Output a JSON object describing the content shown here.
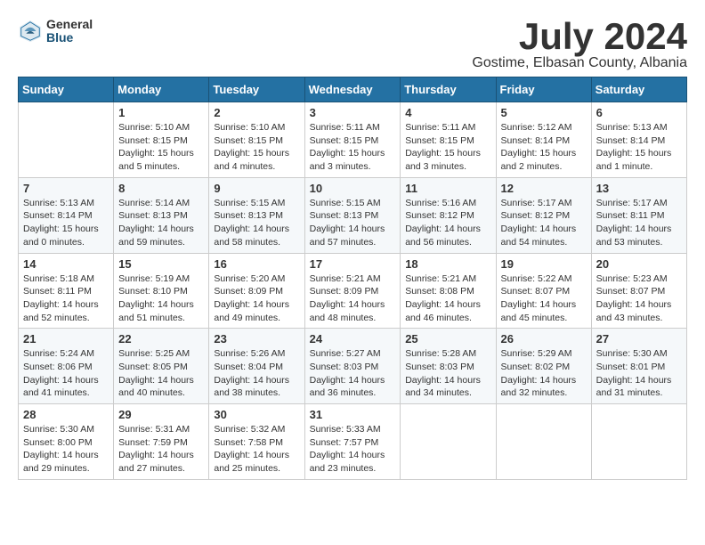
{
  "logo": {
    "general": "General",
    "blue": "Blue"
  },
  "title": "July 2024",
  "subtitle": "Gostime, Elbasan County, Albania",
  "days_of_week": [
    "Sunday",
    "Monday",
    "Tuesday",
    "Wednesday",
    "Thursday",
    "Friday",
    "Saturday"
  ],
  "weeks": [
    [
      {
        "day": "",
        "sunrise": "",
        "sunset": "",
        "daylight": ""
      },
      {
        "day": "1",
        "sunrise": "Sunrise: 5:10 AM",
        "sunset": "Sunset: 8:15 PM",
        "daylight": "Daylight: 15 hours and 5 minutes."
      },
      {
        "day": "2",
        "sunrise": "Sunrise: 5:10 AM",
        "sunset": "Sunset: 8:15 PM",
        "daylight": "Daylight: 15 hours and 4 minutes."
      },
      {
        "day": "3",
        "sunrise": "Sunrise: 5:11 AM",
        "sunset": "Sunset: 8:15 PM",
        "daylight": "Daylight: 15 hours and 3 minutes."
      },
      {
        "day": "4",
        "sunrise": "Sunrise: 5:11 AM",
        "sunset": "Sunset: 8:15 PM",
        "daylight": "Daylight: 15 hours and 3 minutes."
      },
      {
        "day": "5",
        "sunrise": "Sunrise: 5:12 AM",
        "sunset": "Sunset: 8:14 PM",
        "daylight": "Daylight: 15 hours and 2 minutes."
      },
      {
        "day": "6",
        "sunrise": "Sunrise: 5:13 AM",
        "sunset": "Sunset: 8:14 PM",
        "daylight": "Daylight: 15 hours and 1 minute."
      }
    ],
    [
      {
        "day": "7",
        "sunrise": "Sunrise: 5:13 AM",
        "sunset": "Sunset: 8:14 PM",
        "daylight": "Daylight: 15 hours and 0 minutes."
      },
      {
        "day": "8",
        "sunrise": "Sunrise: 5:14 AM",
        "sunset": "Sunset: 8:13 PM",
        "daylight": "Daylight: 14 hours and 59 minutes."
      },
      {
        "day": "9",
        "sunrise": "Sunrise: 5:15 AM",
        "sunset": "Sunset: 8:13 PM",
        "daylight": "Daylight: 14 hours and 58 minutes."
      },
      {
        "day": "10",
        "sunrise": "Sunrise: 5:15 AM",
        "sunset": "Sunset: 8:13 PM",
        "daylight": "Daylight: 14 hours and 57 minutes."
      },
      {
        "day": "11",
        "sunrise": "Sunrise: 5:16 AM",
        "sunset": "Sunset: 8:12 PM",
        "daylight": "Daylight: 14 hours and 56 minutes."
      },
      {
        "day": "12",
        "sunrise": "Sunrise: 5:17 AM",
        "sunset": "Sunset: 8:12 PM",
        "daylight": "Daylight: 14 hours and 54 minutes."
      },
      {
        "day": "13",
        "sunrise": "Sunrise: 5:17 AM",
        "sunset": "Sunset: 8:11 PM",
        "daylight": "Daylight: 14 hours and 53 minutes."
      }
    ],
    [
      {
        "day": "14",
        "sunrise": "Sunrise: 5:18 AM",
        "sunset": "Sunset: 8:11 PM",
        "daylight": "Daylight: 14 hours and 52 minutes."
      },
      {
        "day": "15",
        "sunrise": "Sunrise: 5:19 AM",
        "sunset": "Sunset: 8:10 PM",
        "daylight": "Daylight: 14 hours and 51 minutes."
      },
      {
        "day": "16",
        "sunrise": "Sunrise: 5:20 AM",
        "sunset": "Sunset: 8:09 PM",
        "daylight": "Daylight: 14 hours and 49 minutes."
      },
      {
        "day": "17",
        "sunrise": "Sunrise: 5:21 AM",
        "sunset": "Sunset: 8:09 PM",
        "daylight": "Daylight: 14 hours and 48 minutes."
      },
      {
        "day": "18",
        "sunrise": "Sunrise: 5:21 AM",
        "sunset": "Sunset: 8:08 PM",
        "daylight": "Daylight: 14 hours and 46 minutes."
      },
      {
        "day": "19",
        "sunrise": "Sunrise: 5:22 AM",
        "sunset": "Sunset: 8:07 PM",
        "daylight": "Daylight: 14 hours and 45 minutes."
      },
      {
        "day": "20",
        "sunrise": "Sunrise: 5:23 AM",
        "sunset": "Sunset: 8:07 PM",
        "daylight": "Daylight: 14 hours and 43 minutes."
      }
    ],
    [
      {
        "day": "21",
        "sunrise": "Sunrise: 5:24 AM",
        "sunset": "Sunset: 8:06 PM",
        "daylight": "Daylight: 14 hours and 41 minutes."
      },
      {
        "day": "22",
        "sunrise": "Sunrise: 5:25 AM",
        "sunset": "Sunset: 8:05 PM",
        "daylight": "Daylight: 14 hours and 40 minutes."
      },
      {
        "day": "23",
        "sunrise": "Sunrise: 5:26 AM",
        "sunset": "Sunset: 8:04 PM",
        "daylight": "Daylight: 14 hours and 38 minutes."
      },
      {
        "day": "24",
        "sunrise": "Sunrise: 5:27 AM",
        "sunset": "Sunset: 8:03 PM",
        "daylight": "Daylight: 14 hours and 36 minutes."
      },
      {
        "day": "25",
        "sunrise": "Sunrise: 5:28 AM",
        "sunset": "Sunset: 8:03 PM",
        "daylight": "Daylight: 14 hours and 34 minutes."
      },
      {
        "day": "26",
        "sunrise": "Sunrise: 5:29 AM",
        "sunset": "Sunset: 8:02 PM",
        "daylight": "Daylight: 14 hours and 32 minutes."
      },
      {
        "day": "27",
        "sunrise": "Sunrise: 5:30 AM",
        "sunset": "Sunset: 8:01 PM",
        "daylight": "Daylight: 14 hours and 31 minutes."
      }
    ],
    [
      {
        "day": "28",
        "sunrise": "Sunrise: 5:30 AM",
        "sunset": "Sunset: 8:00 PM",
        "daylight": "Daylight: 14 hours and 29 minutes."
      },
      {
        "day": "29",
        "sunrise": "Sunrise: 5:31 AM",
        "sunset": "Sunset: 7:59 PM",
        "daylight": "Daylight: 14 hours and 27 minutes."
      },
      {
        "day": "30",
        "sunrise": "Sunrise: 5:32 AM",
        "sunset": "Sunset: 7:58 PM",
        "daylight": "Daylight: 14 hours and 25 minutes."
      },
      {
        "day": "31",
        "sunrise": "Sunrise: 5:33 AM",
        "sunset": "Sunset: 7:57 PM",
        "daylight": "Daylight: 14 hours and 23 minutes."
      },
      {
        "day": "",
        "sunrise": "",
        "sunset": "",
        "daylight": ""
      },
      {
        "day": "",
        "sunrise": "",
        "sunset": "",
        "daylight": ""
      },
      {
        "day": "",
        "sunrise": "",
        "sunset": "",
        "daylight": ""
      }
    ]
  ]
}
